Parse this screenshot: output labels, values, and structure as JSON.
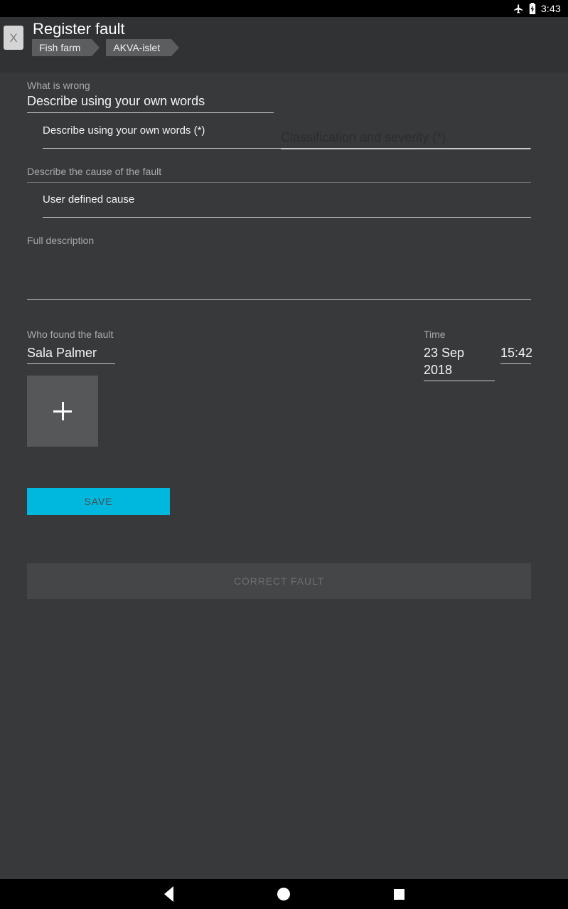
{
  "status_bar": {
    "airplane_icon": "airplane-mode-icon",
    "battery_icon": "battery-charging-icon",
    "time": "3:43"
  },
  "app_bar": {
    "close_label": "X",
    "title": "Register fault",
    "breadcrumbs": [
      {
        "label": "Fish farm"
      },
      {
        "label": "AKVA-islet"
      }
    ]
  },
  "form": {
    "what_is_wrong": {
      "label": "What is wrong",
      "value": "Describe using your own words"
    },
    "classification": {
      "placeholder": "Classification and severity (*)",
      "value": ""
    },
    "own_words_detail": {
      "value": "Describe using your own words (*)"
    },
    "cause_section": {
      "label": "Describe the cause of the fault",
      "value": "User defined cause"
    },
    "full_description": {
      "label": "Full description",
      "value": ""
    },
    "who_found": {
      "label": "Who found the fault",
      "value": "Sala Palmer"
    },
    "time": {
      "label": "Time",
      "date": "23 Sep 2018",
      "clock": "15:42"
    },
    "add_photo": {
      "icon": "plus-icon"
    }
  },
  "actions": {
    "save_label": "SAVE",
    "correct_fault_label": "CORRECT FAULT"
  },
  "nav_bar": {
    "back_icon": "back-triangle-icon",
    "home_icon": "home-circle-icon",
    "recents_icon": "recents-square-icon"
  },
  "colors": {
    "background": "#37393a",
    "app_bar": "#303233",
    "accent": "#00b8de",
    "chip": "#5b5d5e",
    "disabled_button": "#444647"
  }
}
